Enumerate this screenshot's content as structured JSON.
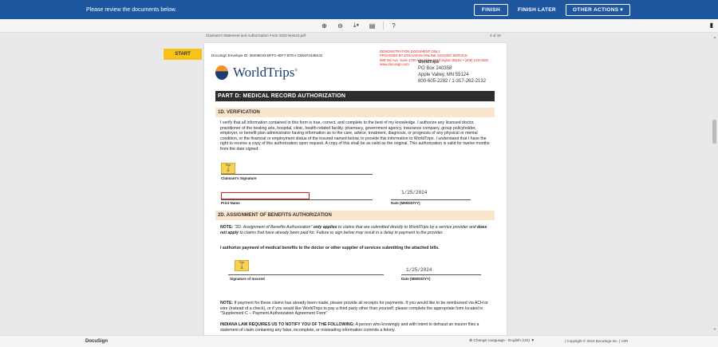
{
  "topbar": {
    "message": "Please review the documents below.",
    "finish": "FINISH",
    "finish_later": "FINISH LATER",
    "other_actions": "OTHER ACTIONS ▾"
  },
  "toolbar": {
    "zoom_in": "⊕",
    "zoom_out": "⊖",
    "download": "⤓▾",
    "print": "▤",
    "help": "?",
    "pages_icon": "▮"
  },
  "docbar": {
    "name": "Claimant's Statement and Authorization Form 2023 NonUS.pdf",
    "pages": "3 of 10"
  },
  "start_label": "START",
  "document": {
    "envelope": "DocuSign Envelope ID: 38406D33-BFF2-4EF7-B7EA-C564F343B242",
    "demo_lines": [
      "DEMONSTRATION DOCUMENT ONLY",
      "PROVIDED BY DOCUSIGN ONLINE SIGNING SERVICE",
      "999 3rd Ave, Suite 1700 • Seattle • Washington 98104 • (206) 219-0200",
      "www.docusign.com"
    ],
    "logo": "WorldTrips",
    "logo_mark": "®",
    "address": {
      "company": "WorldTrips",
      "line1": "PO Box 240358",
      "line2": "Apple Valley, MN 55124",
      "phone": "800-605-2282 / 1-317-262-2132"
    },
    "part_title": "PART D: MEDICAL RECORD AUTHORIZATION",
    "sec1_title": "1D. VERIFICATION",
    "sec1_text": "I verify that all information contained in this form is true, correct, and complete to the best of my knowledge. I authorize any licensed doctor, practitioner of the healing arts, hospital, clinic, health-related facility, pharmacy, government agency, insurance company, group policyholder, employer, or benefit plan administrator having information as to the care, advice, treatment, diagnosis, or prognosis of any physical or mental condition, or the financial or employment status of the insured named below, to provide this information to WorldTrips. I understand that I have the right to receive a copy of this authorization upon request. A copy of this shall be as valid as the original. This authorization is valid for twelve months from the date signed:",
    "sign_label": "Sign",
    "claimant_sig": "Claimant's Signature",
    "print_name": "Print Name",
    "date1": "1/25/2024",
    "date_label": "Date (MM/DD/YY)",
    "sec2_title": "2D. ASSIGNMENT OF BENEFITS AUTHORIZATION",
    "note_label": "NOTE:",
    "note_part1": " \"2D. Assignment of Benefits Authorization\" ",
    "note_only_applies": "only applies",
    "note_part2": " to claims that are submitted directly to WorldTrips by a service provider and ",
    "note_not_apply": "does not apply",
    "note_part3": " to claims that have already been paid for. Failure to sign below may result in a delay in payment to the provider.",
    "authorize_text": "I authorize payment of medical benefits to the doctor or other supplier of services submitting the attached bills.",
    "date2": "1/25/2024",
    "insured_sig": "Signature of Insured",
    "note2_label": "NOTE:",
    "note2_text": " If payment for these claims has already been made, please provide all receipts for payments. If you would like to be reimbursed via ACH or wire (instead of a check), or if you would like WorldTrips to pay a third party other than yourself, please complete the appropriate form located in \"Supplement C – Payment Authorization Agreement Form\"",
    "indiana_label": "INDIANA LAW REQUIRES US TO NOTIFY YOU OF THE FOLLOWING:",
    "indiana_text": " A person who knowingly and with intent to defraud an insurer files a statement of claim containing any false, incomplete, or misleading information commits a felony."
  },
  "footer": {
    "brand": "DocuSign",
    "language": "⊕ Change Language - English (US) ▼",
    "copyright": "|   Copyright © 2024 DocuSign Inc.  |  V2R"
  }
}
